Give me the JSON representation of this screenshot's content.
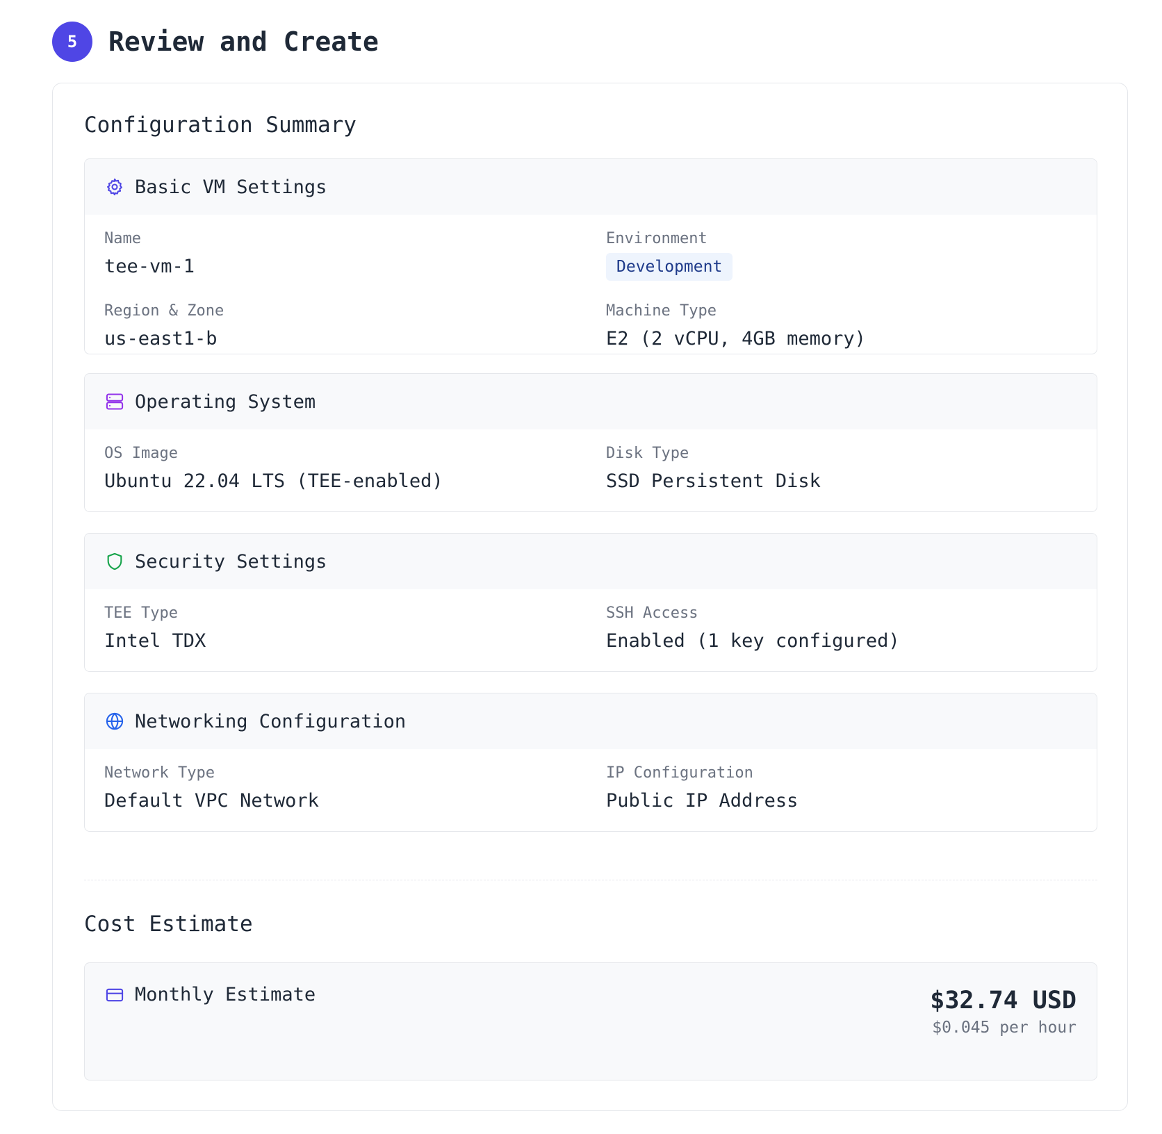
{
  "step": {
    "number": "5",
    "title": "Review and Create"
  },
  "summary": {
    "heading": "Configuration Summary",
    "basic": {
      "title": "Basic VM Settings",
      "icon": "gear-icon",
      "name_label": "Name",
      "name_value": "tee-vm-1",
      "environment_label": "Environment",
      "environment_value": "Development",
      "region_label": "Region & Zone",
      "region_value": "us-east1-b",
      "machine_label": "Machine Type",
      "machine_value": "E2 (2 vCPU, 4GB memory)"
    },
    "os": {
      "title": "Operating System",
      "icon": "server-icon",
      "image_label": "OS Image",
      "image_value": "Ubuntu 22.04 LTS (TEE-enabled)",
      "disk_label": "Disk Type",
      "disk_value": "SSD Persistent Disk"
    },
    "security": {
      "title": "Security Settings",
      "icon": "shield-icon",
      "tee_label": "TEE Type",
      "tee_value": "Intel TDX",
      "ssh_label": "SSH Access",
      "ssh_value": "Enabled (1 key configured)"
    },
    "networking": {
      "title": "Networking Configuration",
      "icon": "globe-icon",
      "network_label": "Network Type",
      "network_value": "Default VPC Network",
      "ip_label": "IP Configuration",
      "ip_value": "Public IP Address"
    }
  },
  "cost": {
    "heading": "Cost Estimate",
    "title": "Monthly Estimate",
    "icon": "credit-card-icon",
    "amount": "$32.74 USD",
    "rate": "$0.045 per hour"
  },
  "colors": {
    "accent": "#4f46e5",
    "gear_icon": "#4f46e5",
    "server_icon": "#9333ea",
    "shield_icon": "#16a34a",
    "globe_icon": "#2563eb",
    "card_icon": "#4f46e5",
    "badge_bg": "#eef4fd",
    "badge_text": "#1e3a8a"
  }
}
